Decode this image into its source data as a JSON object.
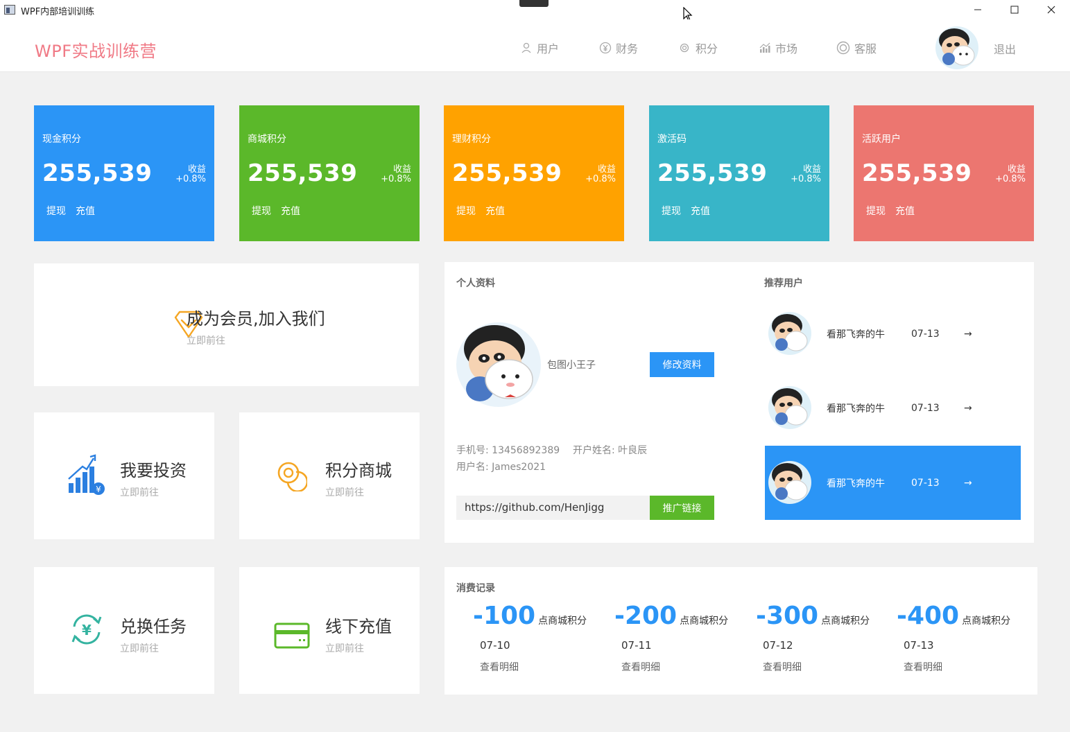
{
  "window": {
    "title": "WPF内部培训训练"
  },
  "header": {
    "brand": "WPF实战训练营",
    "nav": [
      "用户",
      "财务",
      "积分",
      "市场",
      "客服"
    ],
    "logout": "退出"
  },
  "stats": [
    {
      "title": "现金积分",
      "value": "255,539",
      "gain_label": "收益",
      "gain_value": "+0.8%",
      "withdraw": "提现",
      "recharge": "充值",
      "color": "#2b95f6"
    },
    {
      "title": "商城积分",
      "value": "255,539",
      "gain_label": "收益",
      "gain_value": "+0.8%",
      "withdraw": "提现",
      "recharge": "充值",
      "color": "#5bb82a"
    },
    {
      "title": "理财积分",
      "value": "255,539",
      "gain_label": "收益",
      "gain_value": "+0.8%",
      "withdraw": "提现",
      "recharge": "充值",
      "color": "#ffa200"
    },
    {
      "title": "激活码",
      "value": "255,539",
      "gain_label": "收益",
      "gain_value": "+0.8%",
      "withdraw": "提现",
      "recharge": "充值",
      "color": "#38b5c8"
    },
    {
      "title": "活跃用户",
      "value": "255,539",
      "gain_label": "收益",
      "gain_value": "+0.8%",
      "withdraw": "提现",
      "recharge": "充值",
      "color": "#ec7670"
    }
  ],
  "tiles": {
    "member": {
      "title": "成为会员,加入我们",
      "sub": "立即前往"
    },
    "invest": {
      "title": "我要投资",
      "sub": "立即前往"
    },
    "mall": {
      "title": "积分商城",
      "sub": "立即前往"
    },
    "task": {
      "title": "兑换任务",
      "sub": "立即前往"
    },
    "offline": {
      "title": "线下充值",
      "sub": "立即前往"
    }
  },
  "profile": {
    "section": "个人资料",
    "name": "包图小王子",
    "edit_button": "修改资料",
    "phone_label": "手机号:",
    "phone": "13456892389",
    "account_label": "开户姓名:",
    "account": "叶良辰",
    "username_label": "用户名:",
    "username": "James2021",
    "url": "https://github.com/HenJigg",
    "promo_button": "推广链接"
  },
  "recommend": {
    "section": "推荐用户",
    "users": [
      {
        "name": "看那飞奔的牛",
        "date": "07-13",
        "arrow": "→"
      },
      {
        "name": "看那飞奔的牛",
        "date": "07-13",
        "arrow": "→"
      },
      {
        "name": "看那飞奔的牛",
        "date": "07-13",
        "arrow": "→"
      }
    ]
  },
  "consumption": {
    "section": "消费记录",
    "records": [
      {
        "amount": "-100",
        "unit": "点商城积分",
        "date": "07-10",
        "detail": "查看明细"
      },
      {
        "amount": "-200",
        "unit": "点商城积分",
        "date": "07-11",
        "detail": "查看明细"
      },
      {
        "amount": "-300",
        "unit": "点商城积分",
        "date": "07-12",
        "detail": "查看明细"
      },
      {
        "amount": "-400",
        "unit": "点商城积分",
        "date": "07-13",
        "detail": "查看明细"
      }
    ]
  },
  "icons": {
    "nav": [
      "user-icon",
      "finance-icon",
      "points-icon",
      "market-icon",
      "service-icon"
    ],
    "tiles": [
      "diamond-icon",
      "investment-chart-icon",
      "coins-icon",
      "exchange-yen-icon",
      "card-icon"
    ]
  }
}
